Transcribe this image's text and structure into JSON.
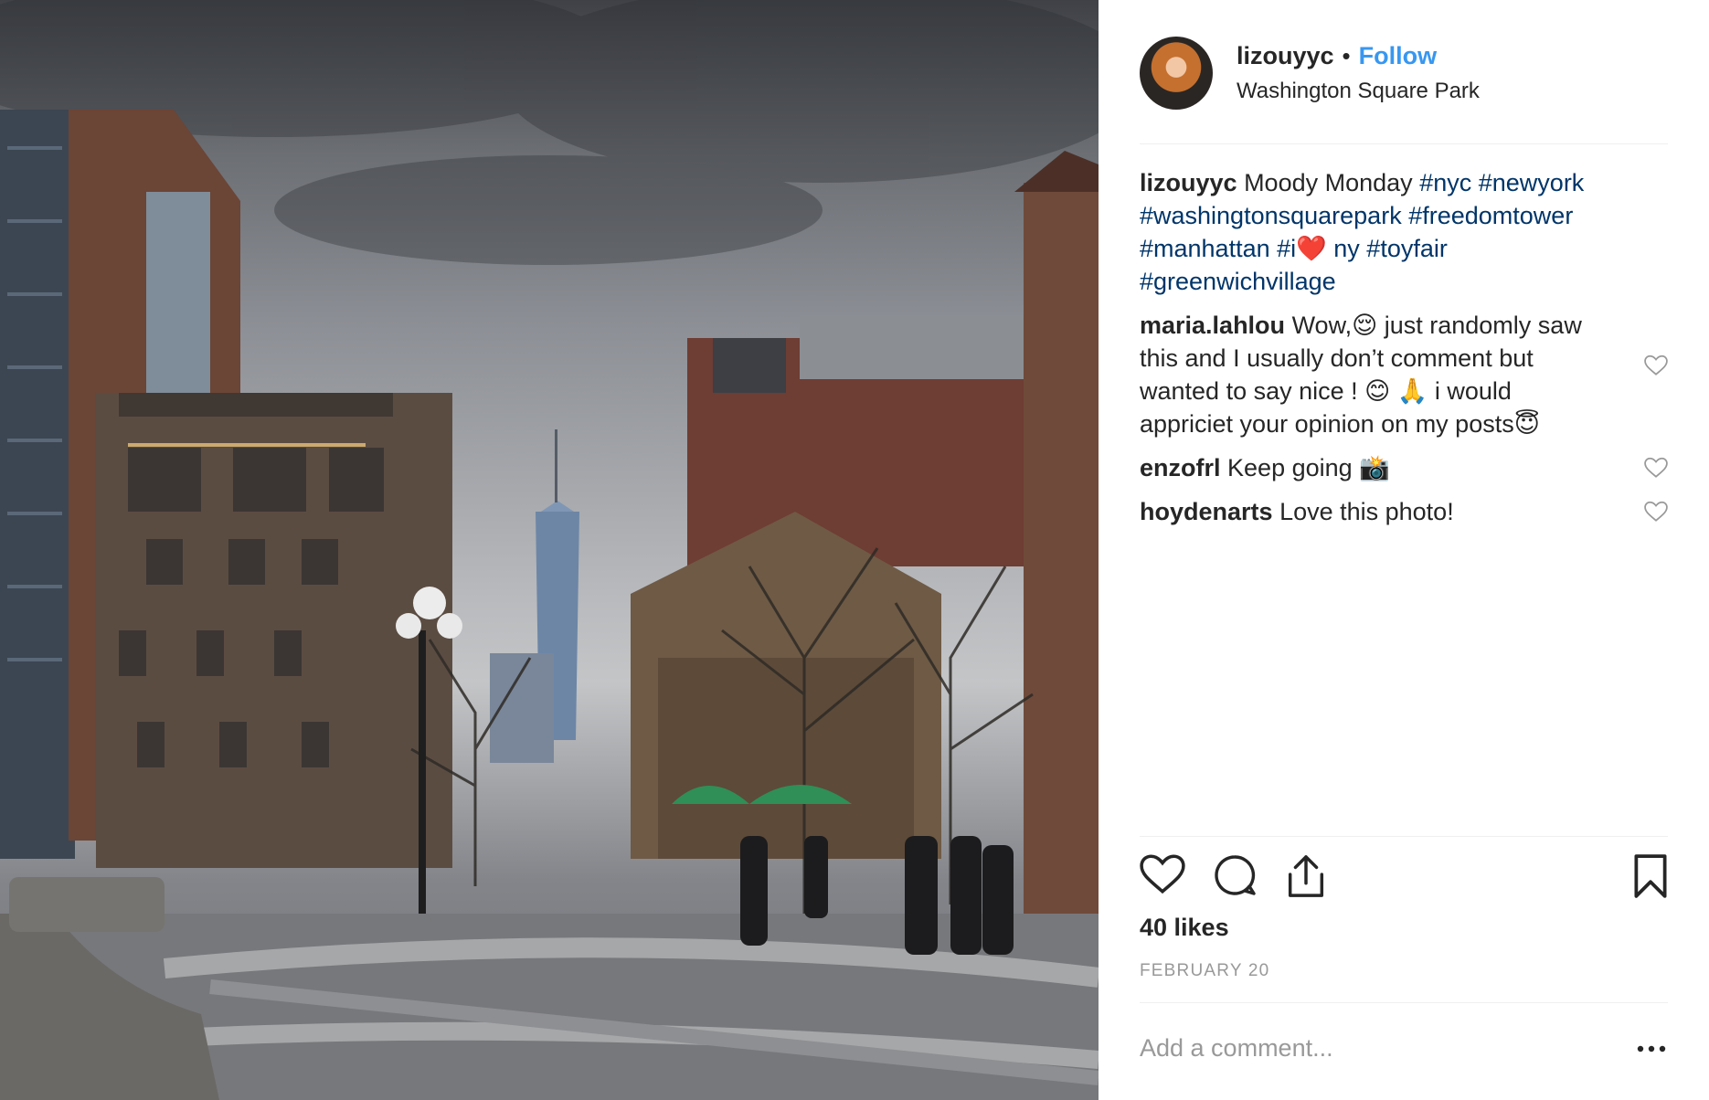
{
  "post": {
    "username": "lizouyyc",
    "separator": "•",
    "follow_label": "Follow",
    "location": "Washington Square Park",
    "photo_icon": "photo-washington-square-park"
  },
  "caption": {
    "username": "lizouyyc",
    "text": "Moody Monday",
    "tags": [
      "#nyc",
      "#newyork",
      "#washingtonsquarepark",
      "#freedomtower",
      "#manhattan",
      "#i❤️ ny",
      "#toyfair",
      "#greenwichvillage"
    ]
  },
  "comments": [
    {
      "username": "maria.lahlou",
      "text": "Wow,😌  just randomly saw this and I usually don’t comment but wanted to say nice ! 😊 🙏  i would appriciet your opinion on my posts😇"
    },
    {
      "username": "enzofrl",
      "text": "Keep going 📸"
    },
    {
      "username": "hoydenarts",
      "text": "Love this photo!"
    }
  ],
  "actions": {
    "icons": [
      "heart-icon",
      "comment-icon",
      "share-icon",
      "bookmark-icon"
    ]
  },
  "likes_label": "40 likes",
  "date_label": "FEBRUARY 20",
  "add_comment": {
    "placeholder": "Add a comment..."
  },
  "more_icon": "more-options-icon",
  "colors": {
    "link": "#003569",
    "follow": "#3897f0",
    "muted": "#999999",
    "text": "#262626"
  }
}
